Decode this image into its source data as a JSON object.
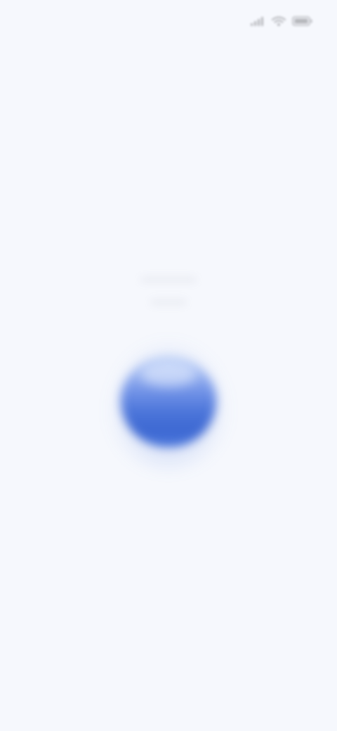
{
  "status_bar": {
    "time": "",
    "icons": [
      "signal-icon",
      "wifi-icon",
      "battery-icon"
    ]
  },
  "orb": {
    "icon": "voice-orb-icon",
    "color_top": "#BCD0F7",
    "color_bottom": "#3D68D2"
  },
  "colors": {
    "background": "#F6F8FD",
    "accent": "#4A74D9"
  }
}
